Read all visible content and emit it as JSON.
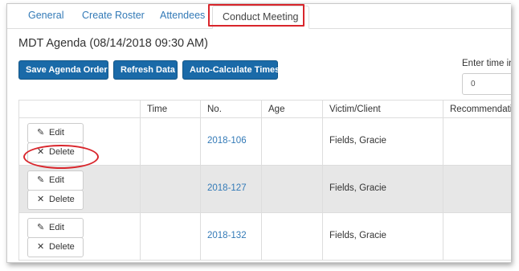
{
  "tabs": [
    {
      "label": "General"
    },
    {
      "label": "Create Roster"
    },
    {
      "label": "Attendees"
    },
    {
      "label": "Conduct Meeting"
    }
  ],
  "agenda_title": "MDT Agenda (08/14/2018 09:30 AM)",
  "toolbar": {
    "save_order": "Save Agenda Order",
    "refresh": "Refresh Data",
    "auto_calc": "Auto-Calculate Times"
  },
  "time_field": {
    "label": "Enter time in",
    "value": "0"
  },
  "table": {
    "headers": [
      "",
      "Time",
      "No.",
      "Age",
      "Victim/Client",
      "Recommendatio"
    ],
    "edit_label": "Edit",
    "delete_label": "Delete",
    "rows": [
      {
        "time": "",
        "no": "2018-106",
        "age": "",
        "victim": "Fields, Gracie",
        "recommendation": ""
      },
      {
        "time": "",
        "no": "2018-127",
        "age": "",
        "victim": "Fields, Gracie",
        "recommendation": ""
      },
      {
        "time": "",
        "no": "2018-132",
        "age": "",
        "victim": "Fields, Gracie",
        "recommendation": ""
      }
    ]
  },
  "colors": {
    "link": "#337ab7",
    "primary_button": "#1a6aa8",
    "highlight": "#d9262c",
    "row_shade": "#e7e7e7"
  },
  "icons": {
    "edit": "pencil-icon",
    "delete": "times-icon"
  }
}
